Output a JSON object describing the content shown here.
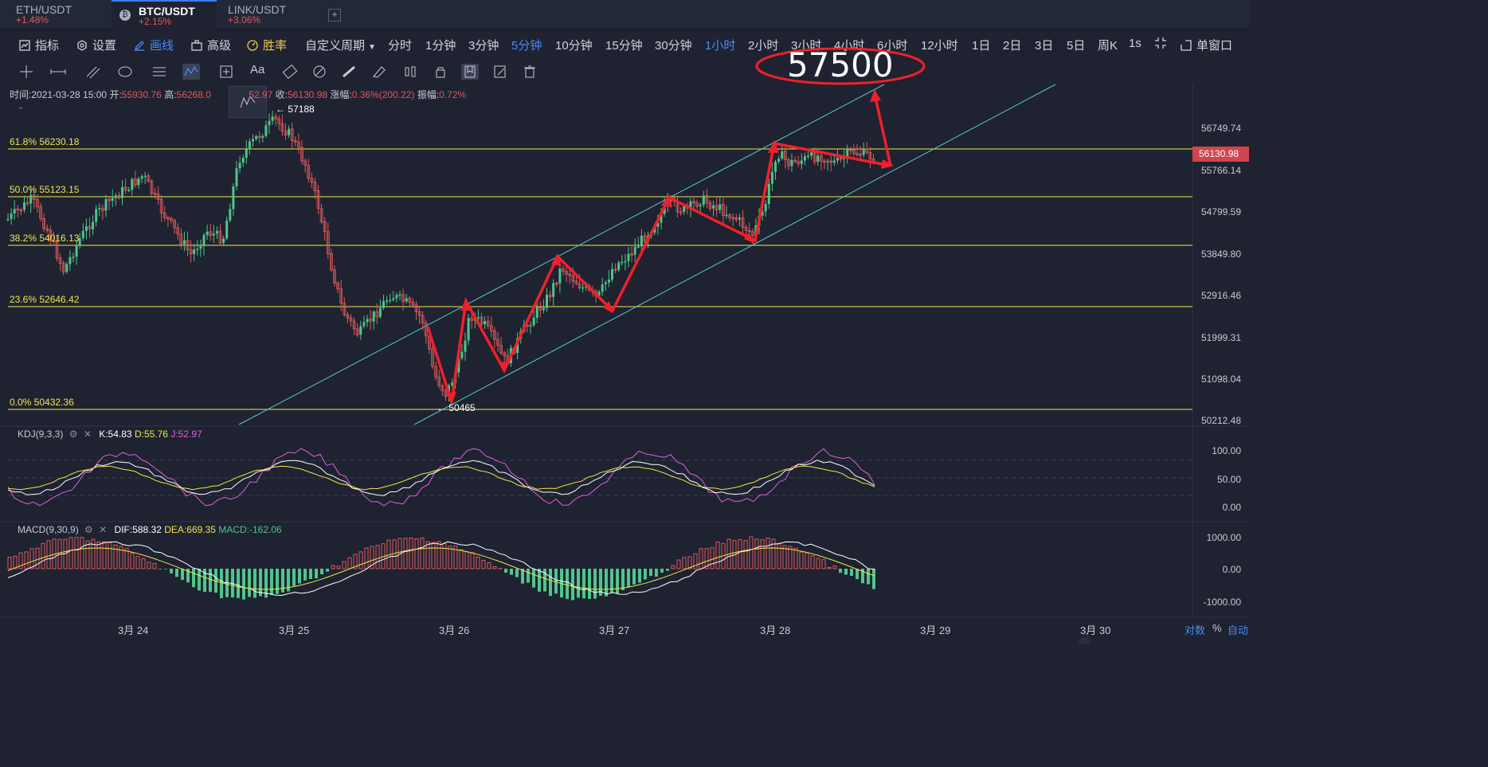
{
  "tabs": [
    {
      "pair": "ETH/USDT",
      "change": "+1.48%"
    },
    {
      "pair": "BTC/USDT",
      "change": "+2.15%"
    },
    {
      "pair": "LINK/USDT",
      "change": "+3.06%"
    }
  ],
  "toolbar": {
    "indicators": "指标",
    "settings": "设置",
    "draw": "画线",
    "advanced": "高级",
    "winrate": "胜率",
    "custom_period": "自定义周期",
    "timeframes": [
      "分时",
      "1分钟",
      "3分钟",
      "5分钟",
      "10分钟",
      "15分钟",
      "30分钟",
      "1小时",
      "2小时",
      "3小时",
      "4小时",
      "6小时",
      "12小时",
      "1日",
      "2日",
      "3日",
      "5日",
      "周K",
      "1s"
    ],
    "layout": "单窗口"
  },
  "ohlc": {
    "time_label": "时间:",
    "time": "2021-03-28 15:00",
    "open_label": "开:",
    "open": "55930.76",
    "high_label": "高:",
    "high": "56268.0",
    "low": "52.97",
    "close_label": "收:",
    "close": "56130.98",
    "chg_label": "涨幅:",
    "chg": "0.36%(200.22)",
    "amp_label": "振幅:",
    "amp": "0.72%"
  },
  "annotations": {
    "target": "57500",
    "high_mark": "57188",
    "low_mark": "50465"
  },
  "fib": [
    {
      "label": "61.8% 56230.18"
    },
    {
      "label": "50.0% 55123.15"
    },
    {
      "label": "38.2% 54016.13"
    },
    {
      "label": "23.6% 52646.42"
    },
    {
      "label": "0.0% 50432.36"
    }
  ],
  "price_axis": [
    "56749.74",
    "55766.14",
    "54799.59",
    "53849.80",
    "52916.46",
    "51999.31",
    "51098.04",
    "50212.48"
  ],
  "current_price": "56130.98",
  "kdj": {
    "name": "KDJ(9,3,3)",
    "k": "K:54.83",
    "d": "D:55.76",
    "j": "J:52.97",
    "axis": [
      "100.00",
      "50.00",
      "0.00"
    ]
  },
  "macd": {
    "name": "MACD(9,30,9)",
    "dif": "DIF:588.32",
    "dea": "DEA:669.35",
    "macd": "MACD:-162.06",
    "axis": [
      "1000.00",
      "0.00",
      "-1000.00"
    ]
  },
  "x_axis": [
    "3月 24",
    "3月 25",
    "3月 26",
    "3月 27",
    "3月 28",
    "3月 29",
    "3月 30"
  ],
  "footer": {
    "log": "对数",
    "pct": "%",
    "auto": "自动"
  },
  "colors": {
    "up": "#4fc58a",
    "down": "#e05a5a",
    "fib": "#f2e64a",
    "channel": "#5ec8c8",
    "annotation": "#f0202a"
  }
}
